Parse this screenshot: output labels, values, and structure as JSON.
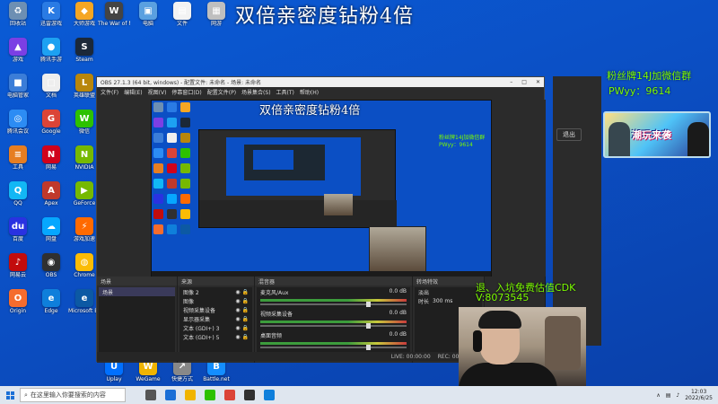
{
  "overlay": {
    "title": "双倍亲密度钻粉4倍",
    "fan_group": "粉丝牌14J加微信群",
    "fan_pw": "PWyy：9614",
    "banner_text": "潮玩来袭",
    "exit_cdk": "退、入坑免费估值CDK",
    "exit_v": "V:8073545"
  },
  "desktop": {
    "left_icons": [
      {
        "label": "回收站",
        "color": "#6d8fb3",
        "glyph": "♻"
      },
      {
        "label": "迅雷游戏",
        "color": "#2a7be4",
        "glyph": "K"
      },
      {
        "label": "大师游戏",
        "color": "#f5a623",
        "glyph": "◆"
      },
      {
        "label": "游戏",
        "color": "#7b3fe4",
        "glyph": "▲"
      },
      {
        "label": "腾讯手游",
        "color": "#1da1f2",
        "glyph": "●"
      },
      {
        "label": "Steam",
        "color": "#1b2838",
        "glyph": "S"
      },
      {
        "label": "电脑管家",
        "color": "#3b7dd8",
        "glyph": "■"
      },
      {
        "label": "文档",
        "color": "#eeeeee",
        "glyph": "□"
      },
      {
        "label": "英雄联盟",
        "color": "#b8860b",
        "glyph": "L"
      },
      {
        "label": "腾讯会议",
        "color": "#2c8cf4",
        "glyph": "◎"
      },
      {
        "label": "Google",
        "color": "#db4437",
        "glyph": "G"
      },
      {
        "label": "微信",
        "color": "#2dc100",
        "glyph": "W"
      },
      {
        "label": "工具",
        "color": "#e67e22",
        "glyph": "≡"
      },
      {
        "label": "网易",
        "color": "#d0021b",
        "glyph": "N"
      },
      {
        "label": "NVIDIA",
        "color": "#76b900",
        "glyph": "N"
      },
      {
        "label": "QQ",
        "color": "#12b7f5",
        "glyph": "Q"
      },
      {
        "label": "Apex",
        "color": "#c0392b",
        "glyph": "A"
      },
      {
        "label": "GeForce",
        "color": "#76b900",
        "glyph": "▶"
      },
      {
        "label": "百度",
        "color": "#2932e1",
        "glyph": "du"
      },
      {
        "label": "网盘",
        "color": "#06a7ff",
        "glyph": "☁"
      },
      {
        "label": "游戏加速",
        "color": "#ff6a00",
        "glyph": "⚡"
      },
      {
        "label": "网易云",
        "color": "#c20c0c",
        "glyph": "♪"
      },
      {
        "label": "OBS",
        "color": "#303030",
        "glyph": "◉"
      },
      {
        "label": "Chrome",
        "color": "#fbbc05",
        "glyph": "◍"
      },
      {
        "label": "Origin",
        "color": "#f56c2d",
        "glyph": "O"
      },
      {
        "label": "Edge",
        "color": "#0f7fdb",
        "glyph": "e"
      },
      {
        "label": "Microsoft Edge",
        "color": "#0c59a4",
        "glyph": "e"
      }
    ],
    "top_icons": [
      {
        "label": "The War of Mine",
        "color": "#444",
        "glyph": "W"
      },
      {
        "label": "电脑",
        "color": "#5aa0e0",
        "glyph": "▣"
      },
      {
        "label": "文件",
        "color": "#f3f3f3",
        "glyph": "▤"
      },
      {
        "label": "网游",
        "color": "#bfbfbf",
        "glyph": "▦"
      }
    ],
    "bottom_icons": [
      {
        "label": "Uplay",
        "color": "#0070ff",
        "glyph": "U"
      },
      {
        "label": "WeGame",
        "color": "#f0b400",
        "glyph": "W"
      },
      {
        "label": "快捷方式",
        "color": "#888",
        "glyph": "↗"
      },
      {
        "label": "Battle.net",
        "color": "#148eff",
        "glyph": "B"
      }
    ]
  },
  "obs": {
    "title": "OBS 27.1.3 (64 bit, windows) - 配置文件: 未命名 - 场景: 未命名",
    "menu": [
      "文件(F)",
      "编辑(E)",
      "视图(V)",
      "停靠窗口(D)",
      "配置文件(P)",
      "场景集合(S)",
      "工具(T)",
      "帮助(H)"
    ],
    "preview_fan": "粉丝牌14J加微信群",
    "preview_pw": "PWyy：9614",
    "docks": {
      "scenes_label": "场景",
      "scene_item": "场景",
      "sources_label": "来源",
      "sources": [
        "图像 2",
        "图像",
        "视频采集设备",
        "显示器采集",
        "文本 (GDI+) 3",
        "文本 (GDI+) 5"
      ],
      "mixer_label": "混音器",
      "mixer_rows": [
        {
          "name": "麦克风/Aux",
          "db": "0.0 dB"
        },
        {
          "name": "视频采集设备",
          "db": "0.0 dB"
        },
        {
          "name": "桌面音频",
          "db": "0.0 dB"
        }
      ],
      "transitions_label": "转场特效",
      "transition": "淡出",
      "duration_label": "时长",
      "duration_value": "300 ms"
    },
    "status": [
      "LIVE: 00:00:00",
      "REC: 00:00:00",
      "CPU: 3.8%, 30.00 fps"
    ],
    "exit_button": "退出"
  },
  "taskbar": {
    "search_placeholder": "在这里输入你要搜索的内容",
    "apps_colors": [
      "#555",
      "#1a6fd6",
      "#f0b400",
      "#2dc100",
      "#db4437",
      "#303030",
      "#0f7fdb"
    ],
    "time": "12:03",
    "date": "2022/6/25"
  }
}
